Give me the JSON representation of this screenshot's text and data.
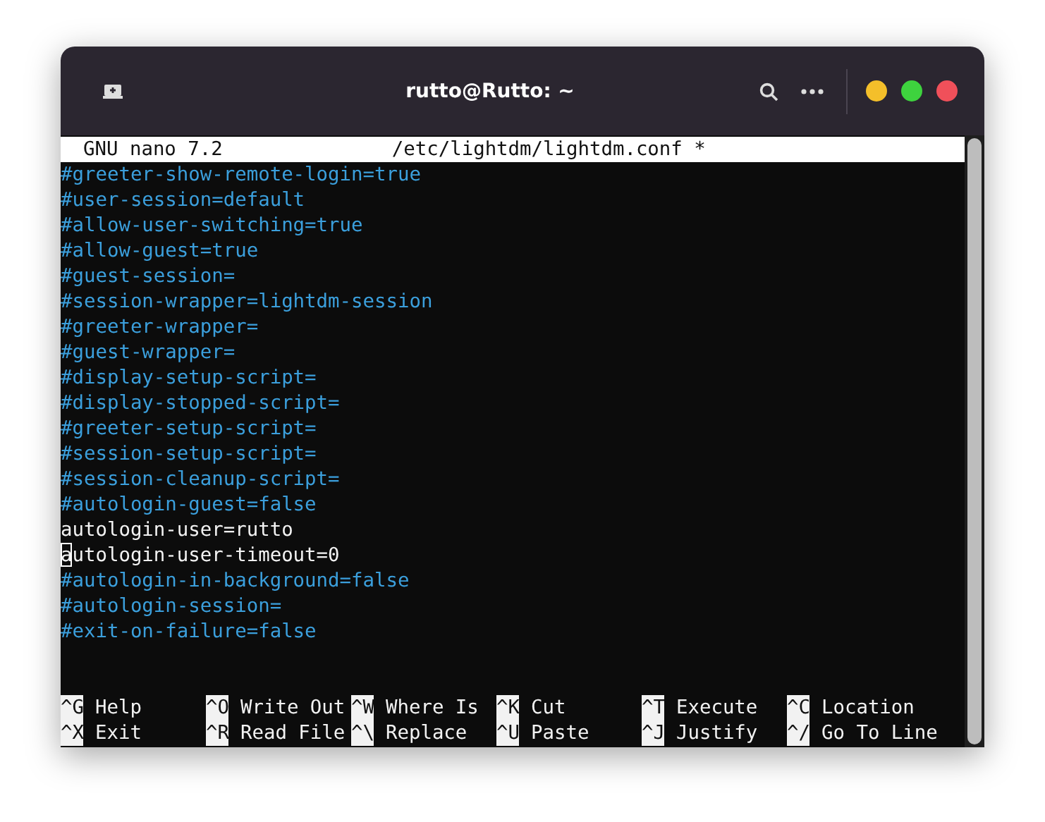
{
  "window": {
    "title": "rutto@Rutto: ~"
  },
  "header": {
    "app": "GNU nano 7.2",
    "file": "/etc/lightdm/lightdm.conf *"
  },
  "lines": [
    {
      "text": "#greeter-show-remote-login=true",
      "kind": "comment",
      "cursor": false
    },
    {
      "text": "#user-session=default",
      "kind": "comment",
      "cursor": false
    },
    {
      "text": "#allow-user-switching=true",
      "kind": "comment",
      "cursor": false
    },
    {
      "text": "#allow-guest=true",
      "kind": "comment",
      "cursor": false
    },
    {
      "text": "#guest-session=",
      "kind": "comment",
      "cursor": false
    },
    {
      "text": "#session-wrapper=lightdm-session",
      "kind": "comment",
      "cursor": false
    },
    {
      "text": "#greeter-wrapper=",
      "kind": "comment",
      "cursor": false
    },
    {
      "text": "#guest-wrapper=",
      "kind": "comment",
      "cursor": false
    },
    {
      "text": "#display-setup-script=",
      "kind": "comment",
      "cursor": false
    },
    {
      "text": "#display-stopped-script=",
      "kind": "comment",
      "cursor": false
    },
    {
      "text": "#greeter-setup-script=",
      "kind": "comment",
      "cursor": false
    },
    {
      "text": "#session-setup-script=",
      "kind": "comment",
      "cursor": false
    },
    {
      "text": "#session-cleanup-script=",
      "kind": "comment",
      "cursor": false
    },
    {
      "text": "#autologin-guest=false",
      "kind": "comment",
      "cursor": false
    },
    {
      "text": "autologin-user=rutto",
      "kind": "setting",
      "cursor": false
    },
    {
      "text": "autologin-user-timeout=0",
      "kind": "setting",
      "cursor": true
    },
    {
      "text": "#autologin-in-background=false",
      "kind": "comment",
      "cursor": false
    },
    {
      "text": "#autologin-session=",
      "kind": "comment",
      "cursor": false
    },
    {
      "text": "#exit-on-failure=false",
      "kind": "comment",
      "cursor": false
    }
  ],
  "shortcuts": [
    {
      "key": "^G",
      "label": "Help"
    },
    {
      "key": "^O",
      "label": "Write Out"
    },
    {
      "key": "^W",
      "label": "Where Is"
    },
    {
      "key": "^K",
      "label": "Cut"
    },
    {
      "key": "^T",
      "label": "Execute"
    },
    {
      "key": "^C",
      "label": "Location"
    },
    {
      "key": "^X",
      "label": "Exit"
    },
    {
      "key": "^R",
      "label": "Read File"
    },
    {
      "key": "^\\",
      "label": "Replace"
    },
    {
      "key": "^U",
      "label": "Paste"
    },
    {
      "key": "^J",
      "label": "Justify"
    },
    {
      "key": "^/",
      "label": "Go To Line"
    }
  ]
}
